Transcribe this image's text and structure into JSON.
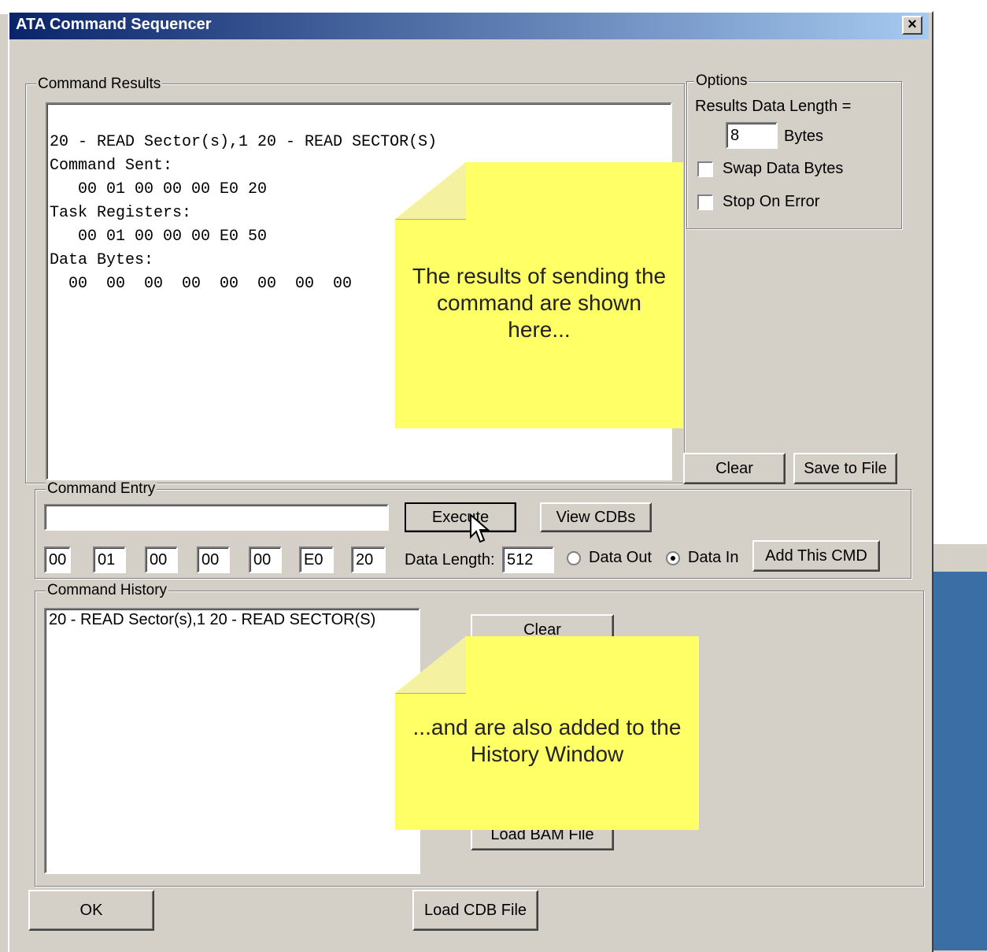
{
  "window": {
    "title": "ATA Command Sequencer",
    "close_label": "×"
  },
  "results": {
    "legend": "Command Results",
    "lines": [
      "20 - READ Sector(s),1 20 - READ SECTOR(S)",
      "Command Sent:",
      "   00 01 00 00 00 E0 20",
      "Task Registers:",
      "   00 01 00 00 00 E0 50",
      "Data Bytes:",
      "  00  00  00  00  00  00  00  00"
    ],
    "clear_label": "Clear",
    "save_label": "Save to File"
  },
  "options": {
    "legend": "Options",
    "data_length_label": "Results Data Length =",
    "data_length_value": "8",
    "bytes_label": "Bytes",
    "swap_label": "Swap Data Bytes",
    "stop_label": "Stop On Error",
    "swap_checked": false,
    "stop_checked": false
  },
  "entry": {
    "legend": "Command Entry",
    "command_value": "",
    "execute_label": "Execute",
    "view_cdbs_label": "View CDBs",
    "registers": [
      "00",
      "01",
      "00",
      "00",
      "00",
      "E0",
      "20"
    ],
    "data_length_label": "Data Length:",
    "data_length_value": "512",
    "data_out_label": "Data Out",
    "data_in_label": "Data In",
    "direction_selected": "Data In",
    "add_label": "Add This CMD"
  },
  "history": {
    "legend": "Command History",
    "items": [
      "20 - READ Sector(s),1 20 - READ SECTOR(S)"
    ],
    "clear_label": "Clear",
    "load_bam_label": "Load BAM File"
  },
  "footer": {
    "ok_label": "OK",
    "load_cdb_label": "Load CDB File"
  },
  "callouts": {
    "results": "The results of sending the command are shown here...",
    "history": "...and are also added to the History Window"
  },
  "colors": {
    "note_yellow": "#ffff66",
    "title_blue": "#0a246a",
    "desktop_blue": "#3a6ea5",
    "dialog_grey": "#d4d0c8"
  }
}
